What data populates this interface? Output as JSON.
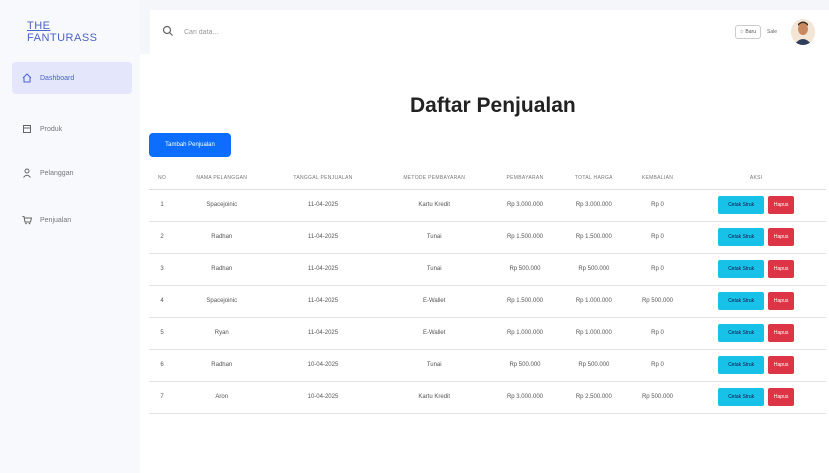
{
  "brand": {
    "line1": "THE",
    "line2": "FANTURASS"
  },
  "sidebar": {
    "items": [
      {
        "label": "Dashboard",
        "icon": "home-icon"
      },
      {
        "label": "Produk",
        "icon": "box-icon"
      },
      {
        "label": "Pelanggan",
        "icon": "user-icon"
      },
      {
        "label": "Penjualan",
        "icon": "cart-icon"
      }
    ]
  },
  "header": {
    "search_placeholder": "Cari data...",
    "btn_small": "Baru",
    "label_small": "Sale"
  },
  "main": {
    "title": "Daftar Penjualan",
    "add_button": "Tambah Penjualan",
    "columns": [
      "No",
      "Nama Pelanggan",
      "Tanggal Penjualan",
      "Metode Pembayaran",
      "Pembayaran",
      "Total Harga",
      "Kembalian",
      "Aksi"
    ],
    "rows": [
      [
        "1",
        "Spacejoinic",
        "11-04-2025",
        "Kartu Kredit",
        "Rp 3.000.000",
        "Rp 3.000.000",
        "Rp 0"
      ],
      [
        "2",
        "Radhan",
        "11-04-2025",
        "Tunai",
        "Rp 1.500.000",
        "Rp 1.500.000",
        "Rp 0"
      ],
      [
        "3",
        "Radhan",
        "11-04-2025",
        "Tunai",
        "Rp 500.000",
        "Rp 500.000",
        "Rp 0"
      ],
      [
        "4",
        "Spacejoinic",
        "11-04-2025",
        "E-Wallet",
        "Rp 1.500.000",
        "Rp 1.000.000",
        "Rp 500.000"
      ],
      [
        "5",
        "Ryan",
        "11-04-2025",
        "E-Wallet",
        "Rp 1.000.000",
        "Rp 1.000.000",
        "Rp 0"
      ],
      [
        "6",
        "Radhan",
        "10-04-2025",
        "Tunai",
        "Rp 500.000",
        "Rp 500.000",
        "Rp 0"
      ],
      [
        "7",
        "Aron",
        "10-04-2025",
        "Kartu Kredit",
        "Rp 3.000.000",
        "Rp 2.500.000",
        "Rp 500.000"
      ]
    ],
    "cetak_label": "Cetak Struk",
    "hapus_label": "Hapus"
  },
  "colors": {
    "accent": "#4a63c8",
    "primary_button": "#0d6efd",
    "info_button": "#17c1e8",
    "danger_button": "#dc3545"
  }
}
